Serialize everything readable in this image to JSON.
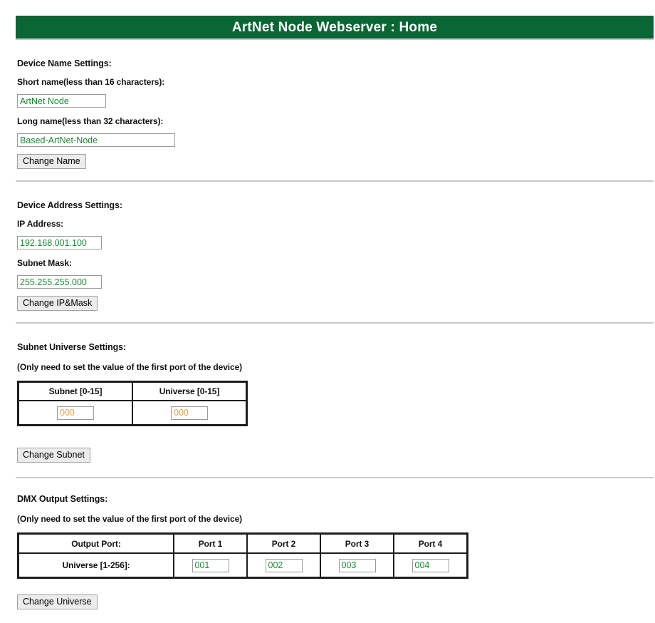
{
  "header": {
    "title": "ArtNet Node Webserver : Home",
    "background_color": "#0a6634",
    "text_color": "#ffffff"
  },
  "colors": {
    "value_green": "#1a8a33",
    "value_amber": "#e8a33d",
    "rule_gray": "#c9c9c9",
    "button_face": "#ececec"
  },
  "device_name": {
    "heading": "Device Name Settings:",
    "short_label": "Short name(less than 16 characters):",
    "short_value": "ArtNet Node",
    "long_label": "Long name(less than 32 characters):",
    "long_value": "Based-ArtNet-Node",
    "button_label": "Change Name"
  },
  "device_address": {
    "heading": "Device Address Settings:",
    "ip_label": "IP Address:",
    "ip_value": "192.168.001.100",
    "mask_label": "Subnet Mask:",
    "mask_value": "255.255.255.000",
    "button_label": "Change IP&Mask"
  },
  "subnet_universe": {
    "heading": "Subnet Universe Settings:",
    "note": "(Only need to set the value of the first port of the device)",
    "columns": [
      "Subnet [0-15]",
      "Universe [0-15]"
    ],
    "values": [
      "000",
      "000"
    ],
    "button_label": "Change Subnet"
  },
  "dmx_output": {
    "heading": "DMX Output Settings:",
    "note": "(Only need to set the value of the first port of the device)",
    "row_header_label": "Output Port:",
    "port_columns": [
      "Port 1",
      "Port 2",
      "Port 3",
      "Port 4"
    ],
    "row_label": "Universe [1-256]:",
    "values": [
      "001",
      "002",
      "003",
      "004"
    ],
    "button_label": "Change Universe"
  }
}
